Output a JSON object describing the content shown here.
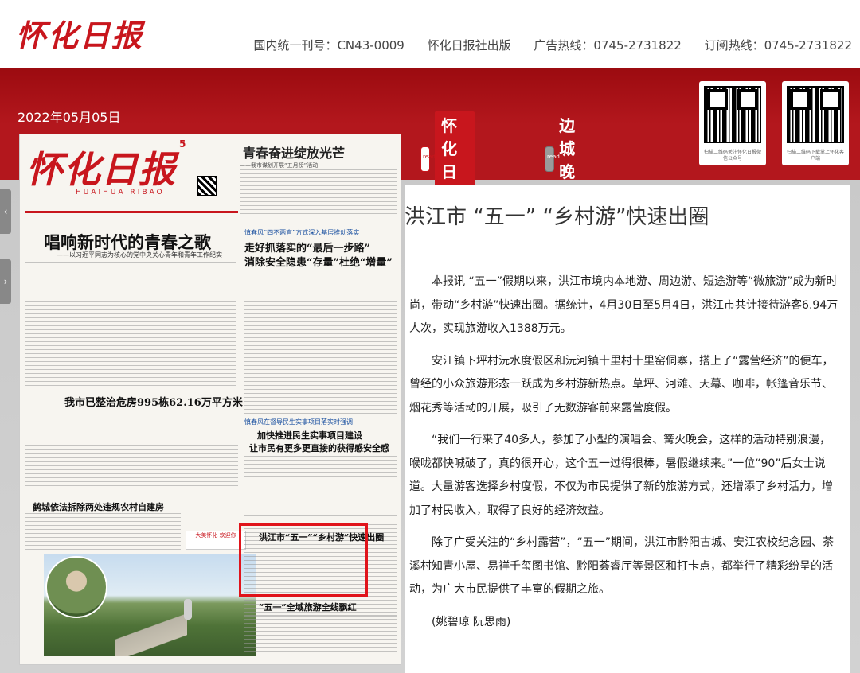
{
  "site": {
    "logo": "怀化日报",
    "issn": "国内统一刊号：CN43-0009",
    "publisher": "怀化日报社出版",
    "ad_hotline": "广告热线：0745-2731822",
    "sub_hotline": "订阅热线：0745-2731822"
  },
  "date": "2022年05月05日",
  "qr_codes": [
    {
      "caption": "扫描二维码关注怀化日报微信公众号"
    },
    {
      "caption": "扫描二维码下载掌上怀化客户端"
    }
  ],
  "tabs": [
    {
      "label": "怀化日报",
      "active": true
    },
    {
      "label": "边城晚报",
      "active": false
    }
  ],
  "newspaper": {
    "masthead": "怀化日报",
    "masthead_pinyin": "HUAIHUA  RIBAO",
    "issue_day": "5",
    "top_title": "青春奋进绽放光芒",
    "top_subtitle": "——我市谋划开展“五月榜”活动",
    "headline_1": "唱响新时代的青春之歌",
    "headline_1_sub": "——以习近平同志为核心的党中央关心青年和青年工作纪实",
    "kicker_2": "慎春风“四不两直”方式深入基层推动落实",
    "headline_2a": "走好抓落实的“最后一步路”",
    "headline_2b": "消除安全隐患“存量”杜绝“增量”",
    "headline_3": "我市已整治危房995栋62.16万平方米",
    "kicker_4": "慎春风在督导民生实事项目落实时强调",
    "headline_4a": "加快推进民生实事项目建设",
    "headline_4b": "让市民有更多更直接的获得感安全感",
    "headline_5": "鹤城依法拆除两处违规农村自建房",
    "ad_text": "大美怀化 欢迎你",
    "headline_6": "洪江市“五一”“乡村游”快速出圈",
    "headline_7": "“五一”全域旅游全线飘红"
  },
  "article": {
    "title": "洪江市  “五一”  “乡村游”快速出圈",
    "paragraphs": [
      "本报讯 “五一”假期以来，洪江市境内本地游、周边游、短途游等“微旅游”成为新时尚，带动“乡村游”快速出圈。据统计，4月30日至5月4日，洪江市共计接待游客6.94万人次，实现旅游收入1388万元。",
      "安江镇下坪村沅水度假区和沅河镇十里村十里窑侗寨，搭上了“露营经济”的便车，曾经的小众旅游形态一跃成为乡村游新热点。草坪、河滩、天幕、咖啡，帐篷音乐节、烟花秀等活动的开展，吸引了无数游客前来露营度假。",
      "“我们一行来了40多人，参加了小型的演唱会、篝火晚会，这样的活动特别浪漫，喉咙都快喊破了，真的很开心，这个五一过得很棒，暑假继续来。”一位“90”后女士说道。大量游客选择乡村度假，不仅为市民提供了新的旅游方式，还增添了乡村活力，增加了村民收入，取得了良好的经济效益。",
      "除了广受关注的“乡村露营”，“五一”期间，洪江市黔阳古城、安江农校纪念园、茶溪村知青小屋、易祥千玺图书馆、黔阳荟睿厅等景区和打卡点，都举行了精彩纷呈的活动，为广大市民提供了丰富的假期之旅。"
    ],
    "author": "(姚碧琼 阮思雨)"
  }
}
